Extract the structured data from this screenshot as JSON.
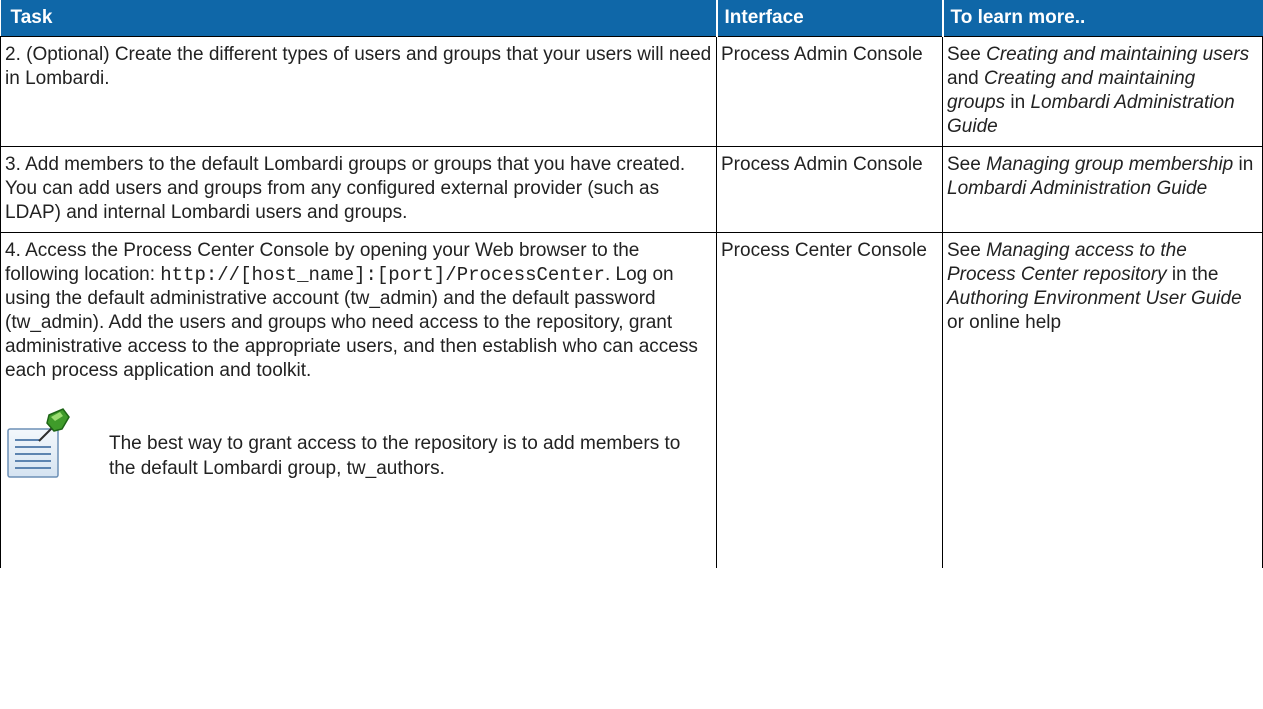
{
  "header": {
    "task": "Task",
    "interface": "Interface",
    "learn_more": "To learn more.."
  },
  "rows": [
    {
      "task": "2. (Optional) Create the different types of users and groups that your users will need in Lombardi.",
      "interface": "Process Admin Console",
      "learn": {
        "see": "See ",
        "ref1": "Creating and maintaining users",
        "and": " and ",
        "ref2": "Creating and maintaining groups",
        "in": " in ",
        "guide": "Lombardi Administration Guide"
      }
    },
    {
      "task": "3. Add members to the default Lombardi groups or groups that you have created. You can add users and groups from any configured external provider (such as LDAP) and internal Lombardi users and groups.",
      "interface": "Process Admin Console",
      "learn": {
        "see": "See ",
        "ref1": "Managing group membership",
        "in": " in ",
        "guide": "Lombardi Administration Guide"
      }
    },
    {
      "task_part1": "4. Access the Process Center Console by opening your Web browser to the following location: ",
      "task_code": "http://[host_name]:[port]/ProcessCenter",
      "task_part2": ". Log on using the default administrative account (tw_admin) and the default password (tw_admin). Add the users and groups who need access to the repository, grant administrative access to the appropriate users, and then establish who can access each process application and toolkit.",
      "note": "The best way to grant access to the repository is to add members to the default Lombardi group, tw_authors.",
      "note_icon": "note-pushpin-icon",
      "interface": "Process Center Console",
      "learn": {
        "see": "See ",
        "ref1": "Managing access to the Process Center repository",
        "in_the": " in the ",
        "guide": "Authoring Environment User Guide",
        "tail": " or online help"
      }
    }
  ],
  "colors": {
    "header_bg": "#0f67a8",
    "header_text": "#ffffff",
    "border": "#000000"
  }
}
